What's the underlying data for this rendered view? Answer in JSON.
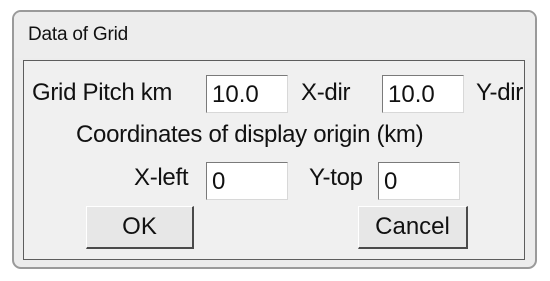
{
  "dialog": {
    "title": "Data of Grid"
  },
  "grid_pitch": {
    "label": "Grid Pitch km",
    "x_value": "10.0",
    "x_label": "X-dir",
    "y_value": "10.0",
    "y_label": "Y-dir"
  },
  "origin": {
    "heading": "Coordinates of display origin (km)",
    "x_label": "X-left",
    "x_value": "0",
    "y_label": "Y-top",
    "y_value": "0"
  },
  "buttons": {
    "ok": "OK",
    "cancel": "Cancel"
  }
}
